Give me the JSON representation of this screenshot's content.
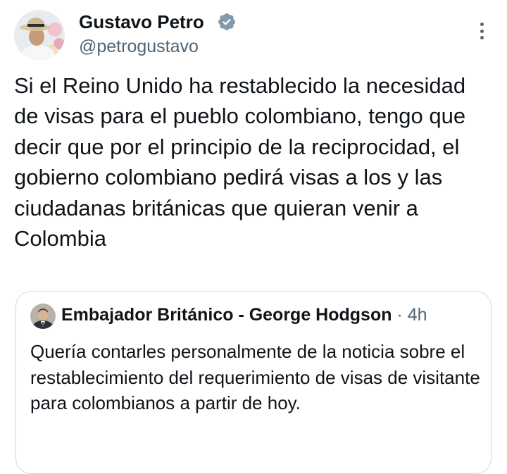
{
  "author": {
    "name": "Gustavo Petro",
    "handle": "@petrogustavo",
    "verified_badge_color": "#829aab"
  },
  "tweet": {
    "text": "Si el Reino Unido ha restablecido la necesidad de visas para el pueblo colombiano, tengo que decir que por el principio de la reciprocidad, el gobierno colombiano pedirá visas a los y las ciudadanas británicas que quieran venir a Colombia"
  },
  "quoted_tweet": {
    "author_name": "Embajador Británico - George Hodgson",
    "separator": "·",
    "time": "4h",
    "text": "Quería contarles personalmente de la noticia sobre el restablecimiento del requerimiento de visas de visitante para colombianos a partir de hoy."
  },
  "icons": {
    "verified": "verified-badge-icon",
    "more": "more-options-icon"
  },
  "colors": {
    "text_primary": "#0f1419",
    "text_secondary": "#536471",
    "border": "#cfd9de"
  }
}
